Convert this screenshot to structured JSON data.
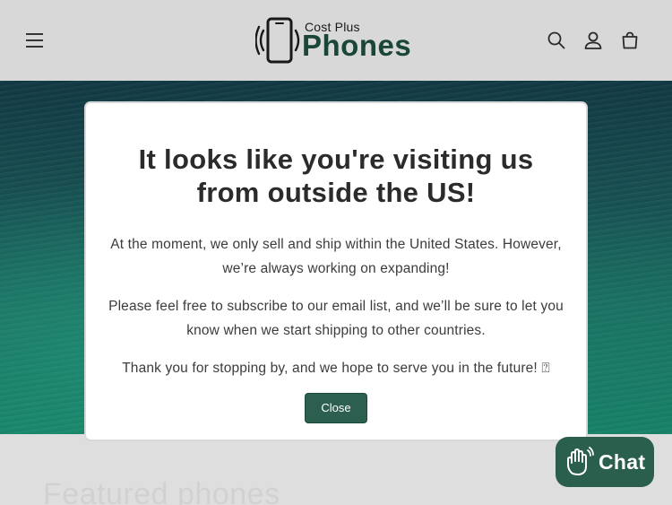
{
  "header": {
    "logo_small": "Cost Plus",
    "logo_big": "Phones"
  },
  "hero": {
    "section_heading": "Featured phones"
  },
  "modal": {
    "title": "It looks like you're visiting us from outside the US!",
    "paragraph_1": "At the moment, we only sell and ship within the United States. However, we’re always working on expanding!",
    "paragraph_2": "Please feel free to subscribe to our email list, and we’ll be sure to let you know when we start shipping to other countries.",
    "paragraph_3": "Thank you for stopping by, and we hope to serve you in the future! ⍰",
    "close_label": "Close"
  },
  "chat": {
    "label": "Chat"
  },
  "colors": {
    "brand_green": "#2c5f4f",
    "logo_green": "#1d4d3f",
    "header_bg": "#ebebeb"
  },
  "icons": [
    "menu-icon",
    "phone-logo-icon",
    "search-icon",
    "account-icon",
    "cart-icon",
    "chat-hand-icon"
  ]
}
